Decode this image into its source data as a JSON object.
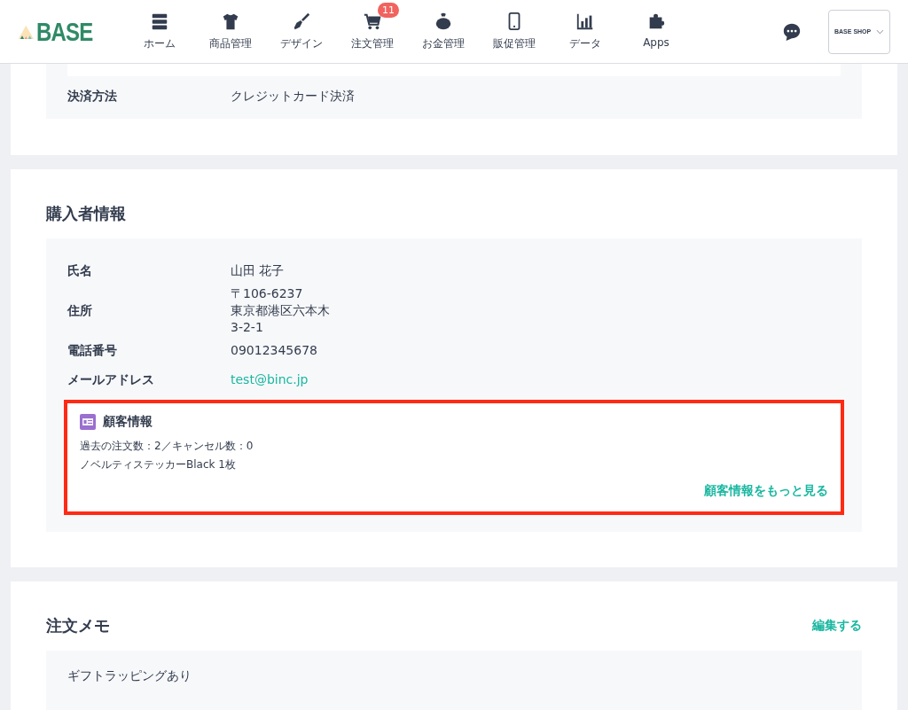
{
  "header": {
    "logo": "BASE",
    "nav": [
      {
        "label": "ホーム"
      },
      {
        "label": "商品管理"
      },
      {
        "label": "デザイン"
      },
      {
        "label": "注文管理",
        "badge": "11"
      },
      {
        "label": "お金管理"
      },
      {
        "label": "販促管理"
      },
      {
        "label": "データ"
      },
      {
        "label": "Apps"
      }
    ],
    "shop": "BASE SHOP"
  },
  "payment": {
    "label": "決済方法",
    "value": "クレジットカード決済"
  },
  "buyer": {
    "title": "購入者情報",
    "rows": [
      {
        "label": "氏名",
        "lines": [
          "山田 花子"
        ],
        "kind": "text"
      },
      {
        "label": "住所",
        "lines": [
          "〒106-6237",
          "東京都港区六本木",
          "3-2-1"
        ],
        "kind": "text"
      },
      {
        "label": "電話番号",
        "lines": [
          "09012345678"
        ],
        "kind": "text"
      },
      {
        "label": "メールアドレス",
        "lines": [
          "test@binc.jp"
        ],
        "kind": "link"
      }
    ],
    "customer": {
      "title": "顧客情報",
      "lines": [
        "過去の注文数：2／キャンセル数：0",
        "ノベルティステッカーBlack 1枚"
      ],
      "more": "顧客情報をもっと見る"
    }
  },
  "memo": {
    "title": "注文メモ",
    "edit": "編集する",
    "text": "ギフトラッピングあり"
  }
}
